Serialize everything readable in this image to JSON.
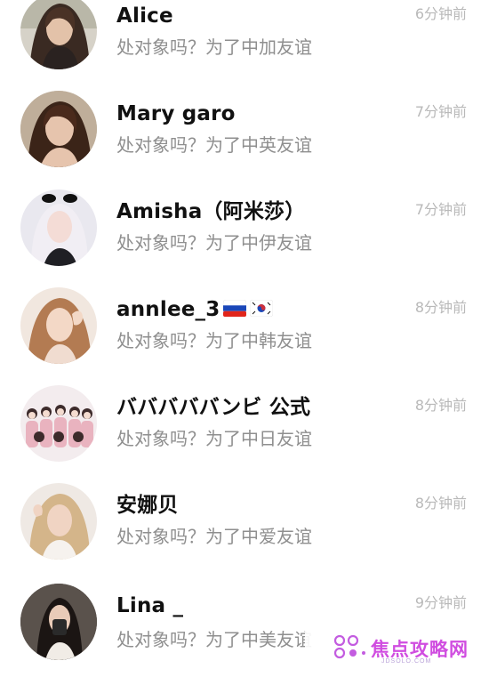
{
  "chats": [
    {
      "name": "Alice",
      "message": "处对象吗？为了中加友谊",
      "time": "6分钟前",
      "avatar": "avatar-alice"
    },
    {
      "name": "Mary garo",
      "message": "处对象吗？为了中英友谊",
      "time": "7分钟前",
      "avatar": "avatar-mary"
    },
    {
      "name": "Amisha（阿米莎）",
      "message": "处对象吗？为了中伊友谊",
      "time": "7分钟前",
      "avatar": "avatar-amisha"
    },
    {
      "name": "annlee_3",
      "message": "处对象吗？为了中韩友谊",
      "time": "8分钟前",
      "avatar": "avatar-annlee",
      "flags": [
        "russia-flag-icon",
        "korea-flag-icon"
      ]
    },
    {
      "name": "バババババンビ 公式",
      "message": "处对象吗？为了中日友谊",
      "time": "8分钟前",
      "avatar": "avatar-group"
    },
    {
      "name": "安娜贝",
      "message": "处对象吗？为了中爱友谊",
      "time": "8分钟前",
      "avatar": "avatar-anna"
    },
    {
      "name": "Lina _",
      "message": "处对象吗？为了中美友谊",
      "time": "9分钟前",
      "avatar": "avatar-lina"
    }
  ],
  "watermark": {
    "text": "焦点攻略网",
    "sub": "JDSOLO.COM"
  },
  "colors": {
    "name": "#111111",
    "message": "#8f8f8f",
    "time": "#b9b9b9",
    "watermark": "#d04de0"
  }
}
